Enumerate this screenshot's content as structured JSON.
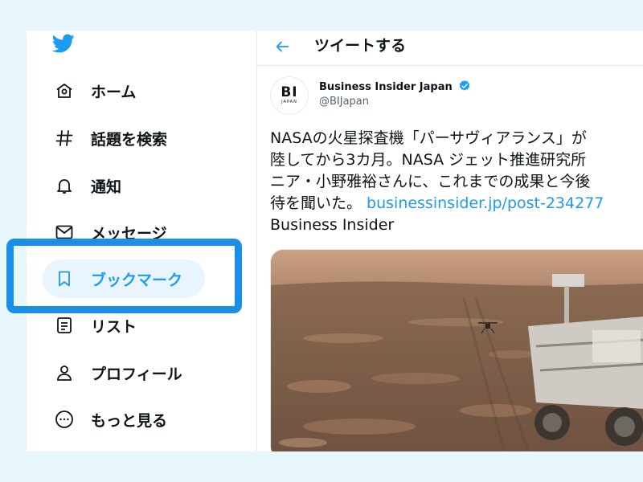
{
  "nav": {
    "items": [
      {
        "label": "ホーム",
        "icon": "home-icon"
      },
      {
        "label": "話題を検索",
        "icon": "hashtag-icon"
      },
      {
        "label": "通知",
        "icon": "bell-icon"
      },
      {
        "label": "メッセージ",
        "icon": "envelope-icon"
      },
      {
        "label": "ブックマーク",
        "icon": "bookmark-icon"
      },
      {
        "label": "リスト",
        "icon": "list-icon"
      },
      {
        "label": "プロフィール",
        "icon": "person-icon"
      },
      {
        "label": "もっと見る",
        "icon": "more-icon"
      }
    ],
    "active_index": 4
  },
  "header": {
    "title": "ツイートする"
  },
  "tweet": {
    "avatar_text": "BI",
    "avatar_subtext": "JAPAN",
    "author_name": "Business Insider Japan",
    "handle": "@BIJapan",
    "text_lines": [
      "NASAの火星探査機「パーサヴィアランス」が",
      "陸してから3カ月。NASA ジェット推進研究所",
      "ニア・小野雅裕さんに、これまでの成果と今後",
      "待を聞いた。 "
    ],
    "link_text": "businessinsider.jp/post-234277",
    "source_text": "Business Insider"
  },
  "colors": {
    "accent": "#1d9bf0",
    "highlight": "#1a8fe8",
    "background": "#e6f6fb"
  }
}
